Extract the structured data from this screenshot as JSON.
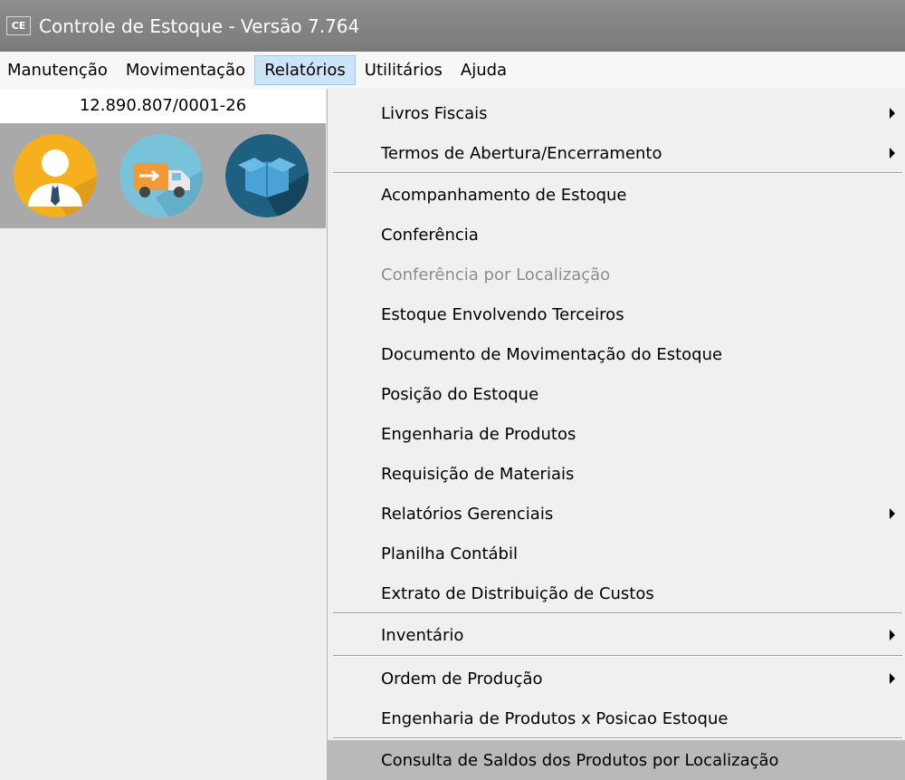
{
  "window": {
    "icon_text": "CE",
    "title": "Controle de Estoque - Versão 7.764"
  },
  "menubar": {
    "items": [
      {
        "label": "Manutenção"
      },
      {
        "label": "Movimentação"
      },
      {
        "label": "Relatórios",
        "active": true
      },
      {
        "label": "Utilitários"
      },
      {
        "label": "Ajuda"
      }
    ]
  },
  "company": {
    "cnpj": "12.890.807/0001-26"
  },
  "shortcuts": [
    {
      "icon": "user-icon",
      "color": "#f6b01e"
    },
    {
      "icon": "delivery-truck-icon",
      "color": "#79c3da"
    },
    {
      "icon": "box-icon",
      "color": "#1f5f7f"
    }
  ],
  "relatorios_menu": {
    "items": [
      {
        "label": "Livros Fiscais",
        "submenu": true
      },
      {
        "label": "Termos de Abertura/Encerramento",
        "submenu": true
      },
      {
        "label": "Acompanhamento de Estoque"
      },
      {
        "label": "Conferência"
      },
      {
        "label": "Conferência por Localização",
        "disabled": true
      },
      {
        "label": "Estoque Envolvendo Terceiros"
      },
      {
        "label": "Documento de Movimentação do Estoque"
      },
      {
        "label": "Posição do Estoque"
      },
      {
        "label": "Engenharia de Produtos"
      },
      {
        "label": "Requisição de Materiais"
      },
      {
        "label": "Relatórios Gerenciais",
        "submenu": true
      },
      {
        "label": "Planilha Contábil"
      },
      {
        "label": "Extrato de Distribuição de Custos"
      },
      {
        "label": "Inventário",
        "submenu": true
      },
      {
        "label": "Ordem de Produção",
        "submenu": true
      },
      {
        "label": "Engenharia de Produtos x Posicao Estoque"
      },
      {
        "label": "Consulta de Saldos dos Produtos por Localização",
        "highlighted": true
      }
    ]
  }
}
